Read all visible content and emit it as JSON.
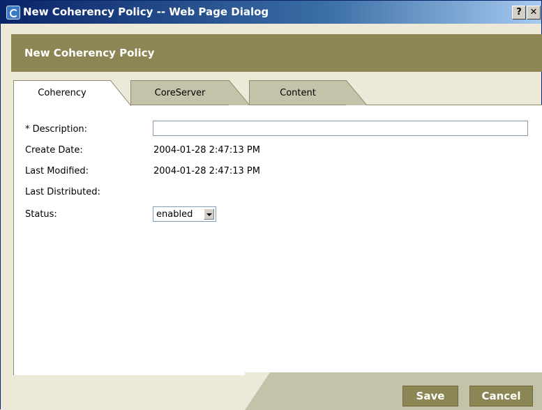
{
  "window": {
    "title": "New Coherency Policy -- Web Page Dialog",
    "help_label": "?",
    "close_label": "✕"
  },
  "header": {
    "title": "New Coherency Policy"
  },
  "tabs": [
    {
      "label": "Coherency",
      "active": true
    },
    {
      "label": "CoreServer",
      "active": false
    },
    {
      "label": "Content",
      "active": false
    }
  ],
  "form": {
    "description": {
      "label": "* Description:",
      "value": ""
    },
    "create_date": {
      "label": "Create Date:",
      "value": "2004-01-28 2:47:13 PM"
    },
    "last_modified": {
      "label": "Last Modified:",
      "value": "2004-01-28 2:47:13 PM"
    },
    "last_distributed": {
      "label": "Last Distributed:",
      "value": ""
    },
    "status": {
      "label": "Status:",
      "value": "enabled"
    }
  },
  "footer": {
    "save_label": "Save",
    "cancel_label": "Cancel"
  },
  "colors": {
    "accent": "#8b8653",
    "tab_inactive": "#c5c2aa",
    "titlebar_start": "#0a246a"
  }
}
